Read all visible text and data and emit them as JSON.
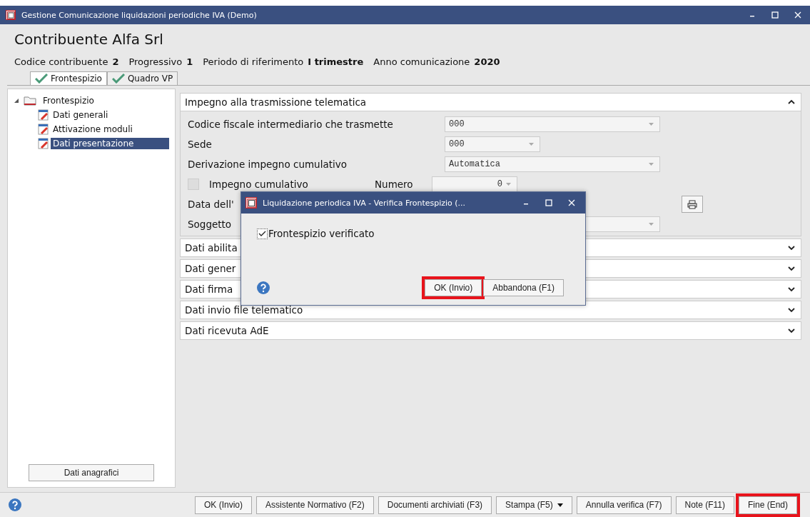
{
  "window": {
    "title": "Gestione Comunicazione liquidazioni periodiche IVA  (Demo)"
  },
  "header": {
    "name": "Contribuente Alfa Srl",
    "info": [
      {
        "label": "Codice contribuente",
        "value": "2"
      },
      {
        "label": "Progressivo",
        "value": "1"
      },
      {
        "label": "Periodo di riferimento",
        "value": "I trimestre"
      },
      {
        "label": "Anno comunicazione",
        "value": "2020"
      }
    ]
  },
  "tabs": [
    {
      "label": "Frontespizio",
      "selected": true,
      "checked": true
    },
    {
      "label": "Quadro VP",
      "selected": false,
      "checked": true
    }
  ],
  "tree": {
    "label": "Frontespizio",
    "expanded": true,
    "children": [
      {
        "label": "Dati generali",
        "selected": false
      },
      {
        "label": "Attivazione moduli",
        "selected": false
      },
      {
        "label": "Dati presentazione",
        "selected": true
      }
    ]
  },
  "side_button": "Dati anagrafici",
  "sections": [
    {
      "title": "Impegno alla trasmissione telematica",
      "expanded": true,
      "fields": [
        {
          "kind": "combo",
          "label": "Codice fiscale intermediario che trasmette",
          "value": "000"
        },
        {
          "kind": "short-combo",
          "label": "Sede",
          "value": "000"
        },
        {
          "kind": "combo",
          "label": "Derivazione impegno cumulativo",
          "value": "Automatica"
        },
        {
          "kind": "check",
          "label": "Impegno cumulativo",
          "checked": false,
          "number_label": "Numero",
          "value": "0"
        },
        {
          "kind": "print",
          "label": "Data dell'"
        },
        {
          "kind": "tail",
          "label": "Soggetto"
        }
      ]
    },
    {
      "title": "Dati abilita",
      "expanded": false
    },
    {
      "title": "Dati gener",
      "expanded": false
    },
    {
      "title": "Dati firma",
      "expanded": false
    },
    {
      "title": "Dati invio file telematico",
      "expanded": false
    },
    {
      "title": "Dati ricevuta AdE",
      "expanded": false
    }
  ],
  "dialog": {
    "title": "Liquidazione periodica IVA - Verifica Frontespizio  (...",
    "checkbox": {
      "label": "Frontespizio verificato",
      "checked": true
    },
    "buttons": [
      {
        "label": "OK (Invio)",
        "highlighted": true
      },
      {
        "label": "Abbandona (F1)",
        "highlighted": false
      }
    ]
  },
  "footer": [
    {
      "label": "OK (Invio)",
      "highlighted": false,
      "kind": "plain"
    },
    {
      "label": "Assistente Normativo (F2)",
      "highlighted": false,
      "kind": "plain"
    },
    {
      "label": "Documenti archiviati (F3)",
      "highlighted": false,
      "kind": "plain"
    },
    {
      "label": "Stampa (F5)",
      "highlighted": false,
      "kind": "dropdown"
    },
    {
      "label": "Annulla verifica (F7)",
      "highlighted": false,
      "kind": "plain"
    },
    {
      "label": "Note (F11)",
      "highlighted": false,
      "kind": "plain"
    },
    {
      "label": "Fine (End)",
      "highlighted": true,
      "kind": "plain"
    }
  ]
}
